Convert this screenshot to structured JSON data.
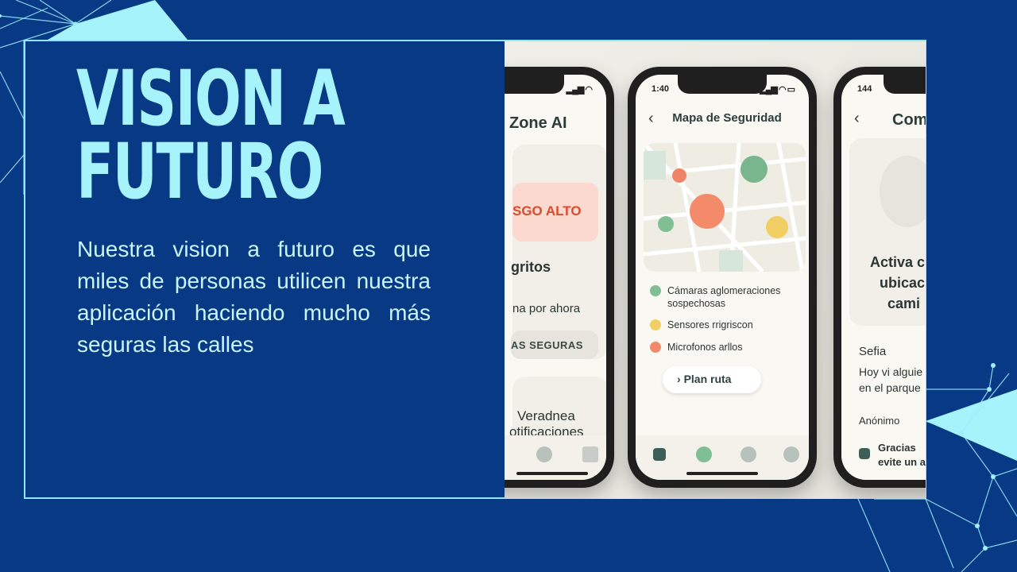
{
  "slide": {
    "title_line1": "VISION A",
    "title_line2": "FUTURO",
    "description": "Nuestra vision a futuro es que miles de personas utilicen nuestra aplicación haciendo mucho más seguras las calles"
  },
  "colors": {
    "background": "#073984",
    "accent": "#a6f3fb",
    "text": "#c9f4fb",
    "frame": "#8fe6f5"
  },
  "phones": {
    "left": {
      "header": "Zone AI",
      "risk_label": "SGO ALTO",
      "section": "gritos",
      "subtext": "na por ahora",
      "button": "AS SEGURAS",
      "card_line1": "Veradnea",
      "card_line2": "otificaciones"
    },
    "middle": {
      "time": "1:40",
      "header": "Mapa de Seguridad",
      "legend": [
        {
          "label": "Cámaras aglomeraciones sospechosas",
          "color": "#7fbf93"
        },
        {
          "label": "Sensores rrigriscon",
          "color": "#f2cf64"
        },
        {
          "label": "Microfonos arllos",
          "color": "#f08a6a"
        }
      ],
      "plan_button": "Plan ruta"
    },
    "right": {
      "time": "144",
      "header": "Com",
      "activate_line1": "Activa c",
      "activate_line2": "ubicac",
      "activate_line3": "cami",
      "post1_author": "Sefia",
      "post1_line1": "Hoy vi alguie",
      "post1_line2": "en el parque",
      "post2_author": "Anónimo",
      "post2_line1": "Gracias",
      "post2_line2": "evite un a"
    }
  }
}
